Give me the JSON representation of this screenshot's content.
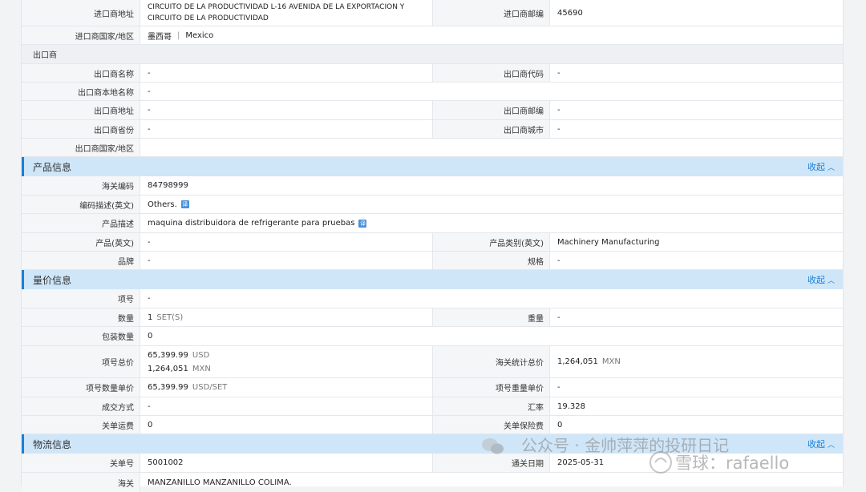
{
  "importer": {
    "address_label": "进口商地址",
    "address_value_line1": "CIRCUITO DE LA PRODUCTIVIDAD L-16 AVENIDA DE LA EXPORTACION Y",
    "address_value_line2": "CIRCUITO DE LA PRODUCTIVIDAD",
    "postcode_label": "进口商邮编",
    "postcode_value": "45690",
    "country_label": "进口商国家/地区",
    "country_value_cn": "墨西哥",
    "country_value_en": "Mexico"
  },
  "exporter": {
    "heading": "出口商",
    "name_label": "出口商名称",
    "name_value": "-",
    "code_label": "出口商代码",
    "code_value": "-",
    "local_name_label": "出口商本地名称",
    "local_name_value": "-",
    "address_label": "出口商地址",
    "address_value": "-",
    "postcode_label": "出口商邮编",
    "postcode_value": "-",
    "province_label": "出口商省份",
    "province_value": "-",
    "city_label": "出口商城市",
    "city_value": "-",
    "country_label": "出口商国家/地区",
    "country_value": ""
  },
  "product": {
    "title": "产品信息",
    "collapse": "收起",
    "hs_label": "海关编码",
    "hs_value": "84798999",
    "code_desc_label": "编码描述(英文)",
    "code_desc_value": "Others.",
    "desc_label": "产品描述",
    "desc_value": "maquina distribuidora de refrigerante para pruebas",
    "product_en_label": "产品(英文)",
    "product_en_value": "-",
    "category_label": "产品类别(英文)",
    "category_value": "Machinery Manufacturing",
    "brand_label": "品牌",
    "brand_value": "-",
    "spec_label": "规格",
    "spec_value": "-",
    "translate_icon": "translate-icon"
  },
  "quantity_price": {
    "title": "量价信息",
    "collapse": "收起",
    "item_no_label": "项号",
    "item_no_value": "-",
    "qty_label": "数量",
    "qty_value": "1",
    "qty_unit": "SET(S)",
    "weight_label": "重量",
    "weight_value": "-",
    "packages_label": "包装数量",
    "packages_value": "0",
    "total_label": "项号总价",
    "total_value_1": "65,399.99",
    "total_unit_1": "USD",
    "total_value_2": "1,264,051",
    "total_unit_2": "MXN",
    "customs_total_label": "海关统计总价",
    "customs_total_value": "1,264,051",
    "customs_total_unit": "MXN",
    "unit_price_label": "项号数量单价",
    "unit_price_value": "65,399.99",
    "unit_price_unit": "USD/SET",
    "weight_price_label": "项号重量单价",
    "weight_price_value": "-",
    "incoterm_label": "成交方式",
    "incoterm_value": "-",
    "rate_label": "汇率",
    "rate_value": "19.328",
    "freight_label": "关单运费",
    "freight_value": "0",
    "insurance_label": "关单保险费",
    "insurance_value": "0"
  },
  "logistics": {
    "title": "物流信息",
    "collapse": "收起",
    "decl_no_label": "关单号",
    "decl_no_value": "5001002",
    "clear_date_label": "通关日期",
    "clear_date_value": "2025-05-31",
    "customs_label": "海关",
    "customs_value": "MANZANILLO MANZANILLO COLIMA."
  },
  "watermark": {
    "text": "公众号 · 金帅萍萍的投研日记",
    "text2": "雪球：rafaello"
  },
  "colors": {
    "accent": "#1b7fd6",
    "section_bg": "#cfe6f8",
    "label_bg": "#f5f6f8"
  }
}
